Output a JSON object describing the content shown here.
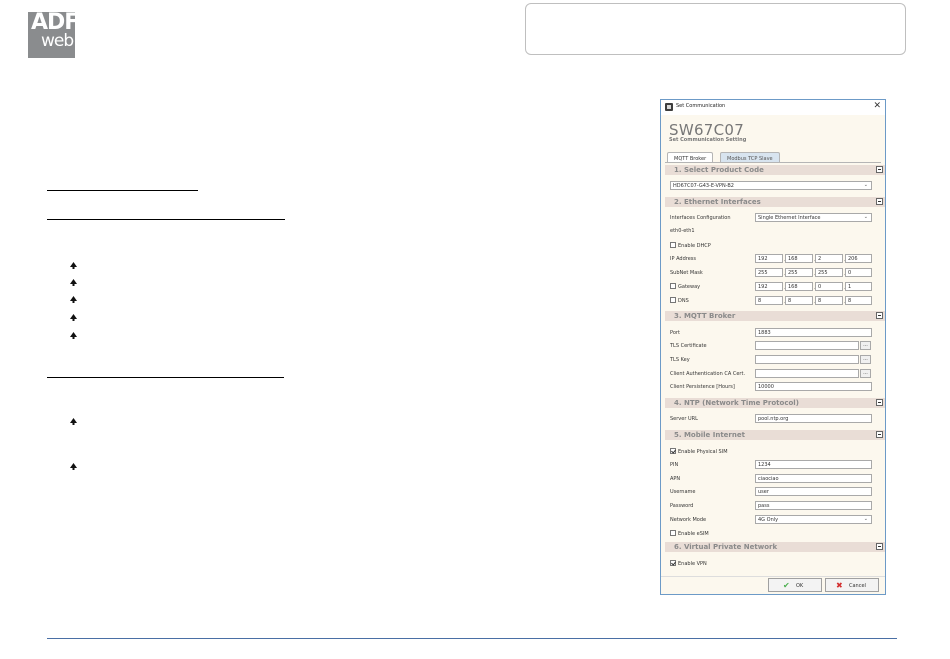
{
  "logo": {
    "line1": "ADF",
    "line2": "web"
  },
  "dialog": {
    "title": "Set Communication",
    "close_glyph": "✕",
    "product": "SW67C07",
    "subtitle": "Set Communication Setting",
    "tabs": [
      "MQTT Broker",
      "Modbus TCP Slave"
    ],
    "sections": {
      "product_code": {
        "header": "1. Select Product Code",
        "value": "HD67C07-G43-E-VPN-B2"
      },
      "ethernet": {
        "header": "2. Ethernet Interfaces",
        "iface_label": "Interfaces Configuration",
        "iface_value": "Single Ethernet Interface",
        "eth_label": "eth0-eth1",
        "dhcp_label": "Enable DHCP",
        "dhcp_checked": false,
        "ip_label": "IP Address",
        "ip": [
          "192",
          "168",
          "2",
          "206"
        ],
        "mask_label": "SubNet Mask",
        "mask": [
          "255",
          "255",
          "255",
          "0"
        ],
        "gateway_label": "Gateway",
        "gateway_checked": false,
        "gateway": [
          "192",
          "168",
          "0",
          "1"
        ],
        "dns_label": "DNS",
        "dns_checked": false,
        "dns": [
          "8",
          "8",
          "8",
          "8"
        ]
      },
      "mqtt": {
        "header": "3. MQTT Broker",
        "port_label": "Port",
        "port": "1883",
        "tls_cert_label": "TLS Certificate",
        "tls_key_label": "TLS Key",
        "ca_label": "Client Authentication CA Cert.",
        "browse_label": "...",
        "persist_label": "Client Persistence [Hours]",
        "persist": "10000"
      },
      "ntp": {
        "header": "4. NTP (Network Time Protocol)",
        "url_label": "Server URL",
        "url": "pool.ntp.org"
      },
      "mobile": {
        "header": "5. Mobile Internet",
        "sim_label": "Enable Physical SIM",
        "sim_checked": true,
        "pin_label": "PIN",
        "pin": "1234",
        "apn_label": "APN",
        "apn": "ciaociao",
        "user_label": "Username",
        "user": "user",
        "pass_label": "Password",
        "pass": "pass",
        "mode_label": "Network Mode",
        "mode": "4G Only",
        "esim_label": "Enable eSIM",
        "esim_checked": false
      },
      "vpn": {
        "header": "6. Virtual Private Network",
        "vpn_label": "Enable VPN",
        "vpn_checked": true
      }
    },
    "buttons": {
      "ok": "OK",
      "cancel": "Cancel"
    }
  },
  "colors": {
    "accent": "#4a6fa5",
    "section_bg": "#e9ddd6",
    "body_bg": "#fcf8ee"
  }
}
